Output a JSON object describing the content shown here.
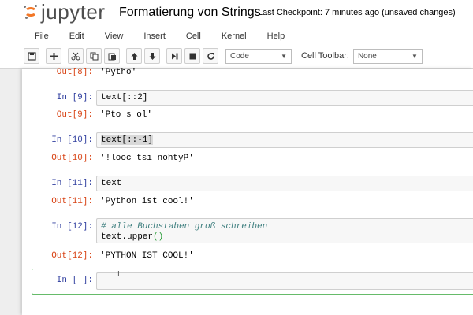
{
  "header": {
    "logo_text": "jupyter",
    "notebook_title": "Formatierung von Strings",
    "checkpoint": "Last Checkpoint: 7 minutes ago (unsaved changes)"
  },
  "menu": [
    "File",
    "Edit",
    "View",
    "Insert",
    "Cell",
    "Kernel",
    "Help"
  ],
  "toolbar": {
    "buttons": [
      "save-icon",
      "plus-icon",
      "scissors-icon",
      "copy-icon",
      "paste-icon",
      "arrow-up-icon",
      "arrow-down-icon",
      "step-forward-icon",
      "stop-icon",
      "restart-icon"
    ],
    "cell_type": "Code",
    "cell_toolbar_label": "Cell Toolbar:",
    "cell_toolbar_value": "None"
  },
  "cells": [
    {
      "out_prompt": "Out[8]:",
      "output": "'Pytho'"
    },
    {
      "in_prompt": "In [9]:",
      "code": "text[::2]",
      "out_prompt": "Out[9]:",
      "output": "'Pto s ol'"
    },
    {
      "in_prompt": "In [10]:",
      "code": "text[::-1]",
      "out_prompt": "Out[10]:",
      "output": "'!looc tsi nohtyP'"
    },
    {
      "in_prompt": "In [11]:",
      "code": "text",
      "out_prompt": "Out[11]:",
      "output": "'Python ist cool!'"
    },
    {
      "in_prompt": "In [12]:",
      "comment": "# alle Buchstaben groß schreiben",
      "code_line2": "text.upper",
      "code_parens": "()",
      "out_prompt": "Out[12]:",
      "output": "'PYTHON IST COOL!'"
    },
    {
      "in_prompt": "In [ ]:"
    }
  ],
  "colors": {
    "in_prompt": "#303f9f",
    "out_prompt": "#d84315",
    "active_cell_border": "#66bb6a",
    "logo_orange": "#f37726"
  }
}
